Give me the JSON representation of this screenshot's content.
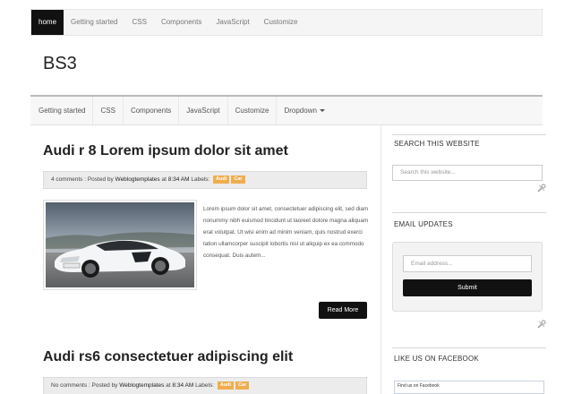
{
  "topnav": {
    "items": [
      "home",
      "Getting started",
      "CSS",
      "Components",
      "JavaScript",
      "Customize"
    ]
  },
  "brand": "BS3",
  "subnav": {
    "items": [
      "Getting started",
      "CSS",
      "Components",
      "JavaScript",
      "Customize"
    ],
    "dropdown_label": "Dropdown"
  },
  "posts": [
    {
      "title": "Audi r 8 Lorem ipsum dolor sit amet",
      "comments": "4 comments",
      "meta_posted": " : Posted by ",
      "author": "Weblogtemplates",
      "meta_at": " at ",
      "time": "8:34 AM",
      "meta_labels": " Labels: ",
      "labels": [
        "Audi",
        "Car"
      ],
      "excerpt": "Lorem ipsum dolor sit amet, consectetuer adipiscing elit, sed diam nonummy nibh euismod tincidunt ut laoreet dolore magna aliquam erat volutpat. Ut wisi enim ad minim veniam, quis nostrud exerci tation ullamcorper suscipit lobortis nisl ut aliquip ex ea commodo consequat. Duis autem...",
      "read_more": "Read More"
    },
    {
      "title": "Audi rs6 consectetuer adipiscing elit",
      "comments": "No comments",
      "meta_posted": " : Posted by ",
      "author": "Weblogtemplates",
      "meta_at": " at ",
      "time": "8:34 AM",
      "meta_labels": " Labels: ",
      "labels": [
        "Audi",
        "Car"
      ]
    }
  ],
  "sidebar": {
    "search": {
      "title": "SEARCH THIS WEBSITE",
      "placeholder": "Search this website..."
    },
    "email": {
      "title": "EMAIL UPDATES",
      "placeholder": "Email address...",
      "submit": "Submit"
    },
    "facebook": {
      "title": "LIKE US ON FACEBOOK",
      "box_label": "Find us on Facebook"
    }
  },
  "colors": {
    "nav_active": "#111111",
    "tag": "#f0ad4e",
    "button": "#111111"
  }
}
